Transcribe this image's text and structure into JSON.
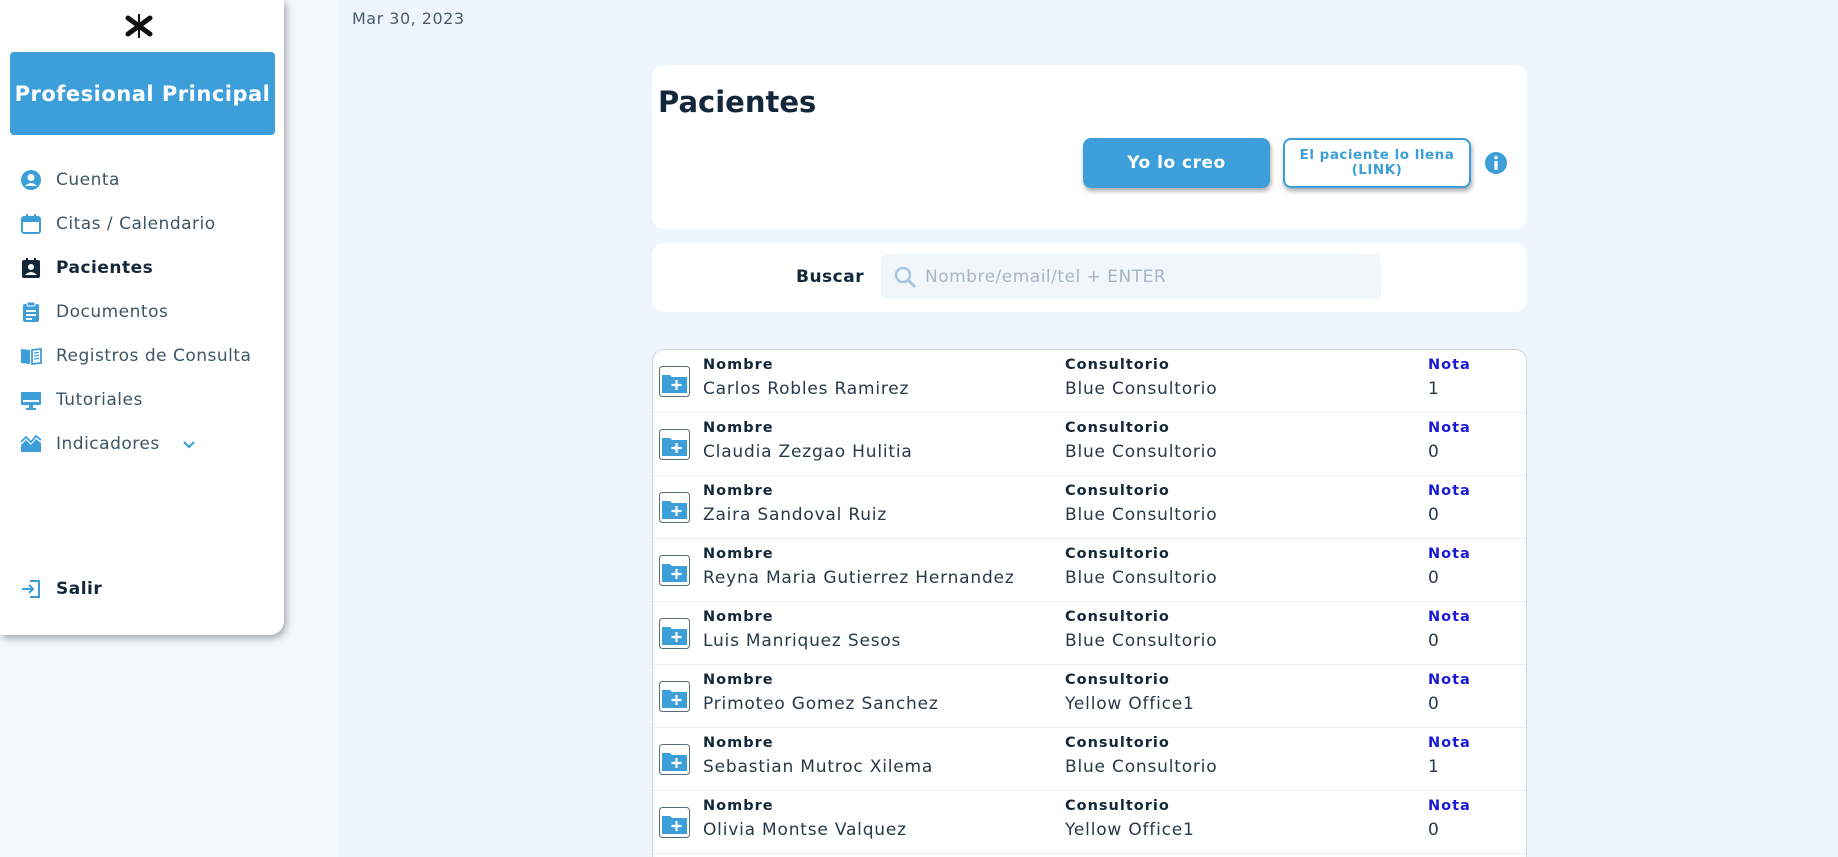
{
  "header": {
    "date": "Mar 30, 2023"
  },
  "sidebar": {
    "brand": "Profesional Principal",
    "logo_icon": "caduceus-icon",
    "items": [
      {
        "label": "Cuenta",
        "icon": "account-circle-icon",
        "active": false
      },
      {
        "label": "Citas / Calendario",
        "icon": "calendar-icon",
        "active": false
      },
      {
        "label": "Pacientes",
        "icon": "patient-badge-icon",
        "active": true
      },
      {
        "label": "Documentos",
        "icon": "clipboard-icon",
        "active": false
      },
      {
        "label": "Registros de Consulta",
        "icon": "book-icon",
        "active": false
      },
      {
        "label": "Tutoriales",
        "icon": "monitor-icon",
        "active": false
      },
      {
        "label": "Indicadores",
        "icon": "chart-icon",
        "active": false,
        "expandable": true
      }
    ],
    "logout": "Salir"
  },
  "main": {
    "title": "Pacientes",
    "create_button": "Yo lo creo",
    "link_button": "El paciente lo llena (LINK)",
    "search": {
      "label": "Buscar",
      "placeholder": "Nombre/email/tel + ENTER",
      "value": ""
    },
    "columns": {
      "name": "Nombre",
      "office": "Consultorio",
      "note": "Nota"
    },
    "patients": [
      {
        "name": "Carlos  Robles  Ramirez",
        "office": "Blue Consultorio",
        "note": "1"
      },
      {
        "name": "Claudia  Zezgao  Hulitia",
        "office": "Blue Consultorio",
        "note": "0"
      },
      {
        "name": "Zaira  Sandoval  Ruiz",
        "office": "Blue Consultorio",
        "note": "0"
      },
      {
        "name": "Reyna Maria  Gutierrez  Hernandez",
        "office": "Blue Consultorio",
        "note": "0"
      },
      {
        "name": "Luis  Manriquez  Sesos",
        "office": "Blue Consultorio",
        "note": "0"
      },
      {
        "name": "Primoteo  Gomez  Sanchez",
        "office": "Yellow Office1",
        "note": "0"
      },
      {
        "name": "Sebastian  Mutroc  Xilema",
        "office": "Blue Consultorio",
        "note": "1"
      },
      {
        "name": "Olivia  Montse  Valquez",
        "office": "Yellow Office1",
        "note": "0"
      }
    ]
  },
  "colors": {
    "accent": "#3d9fd9",
    "note_label": "#1a1ad6",
    "background": "#eef5fc"
  }
}
